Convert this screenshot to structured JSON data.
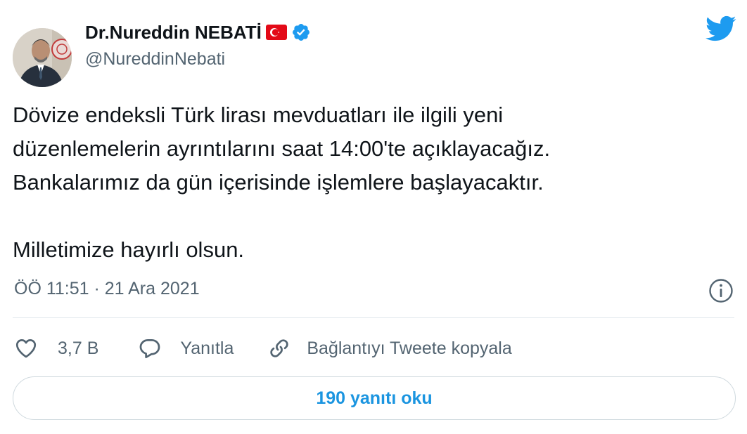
{
  "author": {
    "name": "Dr.Nureddin NEBATİ",
    "handle": "@NureddinNebati",
    "flag_icon": "turkey-flag-icon",
    "verified_icon": "verified-badge-icon"
  },
  "brand": {
    "logo_icon": "twitter-bird-icon",
    "color": "#1d9bf0"
  },
  "tweet": {
    "paragraph1_lines": [
      "Dövize endeksli Türk lirası mevduatları ile ilgili yeni",
      "düzenlemelerin ayrıntılarını saat 14:00'te açıklayacağız.",
      "Bankalarımız da gün içerisinde işlemlere başlayacaktır."
    ],
    "paragraph2": "Milletimize hayırlı olsun.",
    "timestamp": "ÖÖ 11:51 · 21 Ara 2021"
  },
  "actions": {
    "like_count": "3,7 B",
    "reply_label": "Yanıtla",
    "copy_link_label": "Bağlantıyı Tweete kopyala"
  },
  "read_replies_label": "190 yanıtı oku",
  "colors": {
    "text": "#0f1419",
    "secondary": "#536471",
    "link": "#1b95e0",
    "verified": "#1d9bf0",
    "flag_red": "#e30a17",
    "border": "#cfd9de"
  }
}
